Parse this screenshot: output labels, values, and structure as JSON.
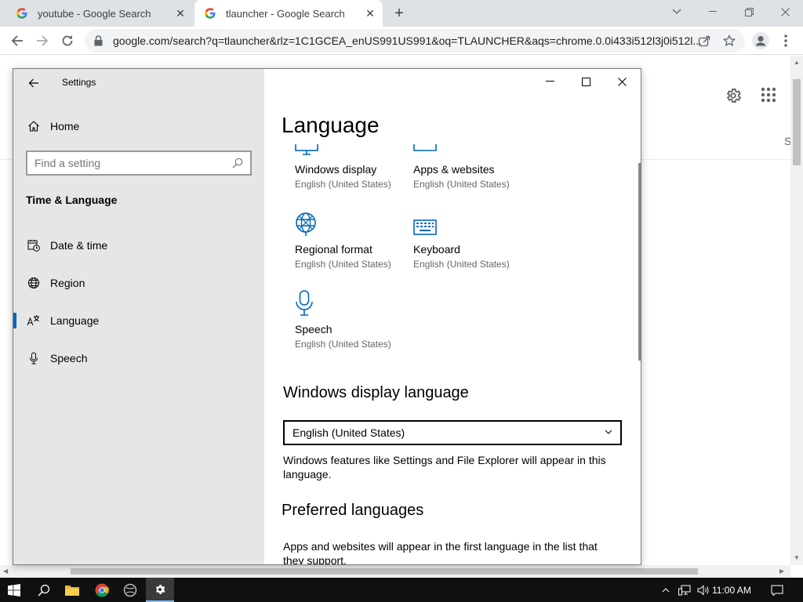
{
  "browser": {
    "tabs": [
      {
        "title": "youtube - Google Search",
        "active": false
      },
      {
        "title": "tlauncher - Google Search",
        "active": true
      }
    ],
    "new_tab": "+",
    "address": "google.com/search?q=tlauncher&rlz=1C1GCEA_enUS991US991&oq=TLAUNCHER&aqs=chrome.0.0i433i512l3j0i512l..."
  },
  "google_page": {
    "partial_tab": "S"
  },
  "settings": {
    "window_title": "Settings",
    "home_label": "Home",
    "search_placeholder": "Find a setting",
    "section_title": "Time & Language",
    "nav": [
      {
        "label": "Date & time",
        "icon": "calendar-clock-icon"
      },
      {
        "label": "Region",
        "icon": "globe-icon"
      },
      {
        "label": "Language",
        "icon": "language-icon",
        "selected": true
      },
      {
        "label": "Speech",
        "icon": "microphone-icon"
      }
    ],
    "page_title": "Language",
    "tiles": [
      {
        "label": "Windows display",
        "sub": "English (United States)",
        "icon": "monitor-icon"
      },
      {
        "label": "Apps & websites",
        "sub": "English (United States)",
        "icon": "window-icon"
      },
      {
        "label": "Regional format",
        "sub": "English (United States)",
        "icon": "globe-settings-icon"
      },
      {
        "label": "Keyboard",
        "sub": "English (United States)",
        "icon": "keyboard-icon"
      },
      {
        "label": "Speech",
        "sub": "English (United States)",
        "icon": "microphone-icon"
      }
    ],
    "display_language": {
      "heading": "Windows display language",
      "selected": "English (United States)",
      "description": "Windows features like Settings and File Explorer will appear in this language."
    },
    "preferred": {
      "heading": "Preferred languages",
      "description": "Apps and websites will appear in the first language in the list that they support."
    },
    "accent_color": "#0067c0"
  },
  "taskbar": {
    "time": "11:00 AM"
  }
}
